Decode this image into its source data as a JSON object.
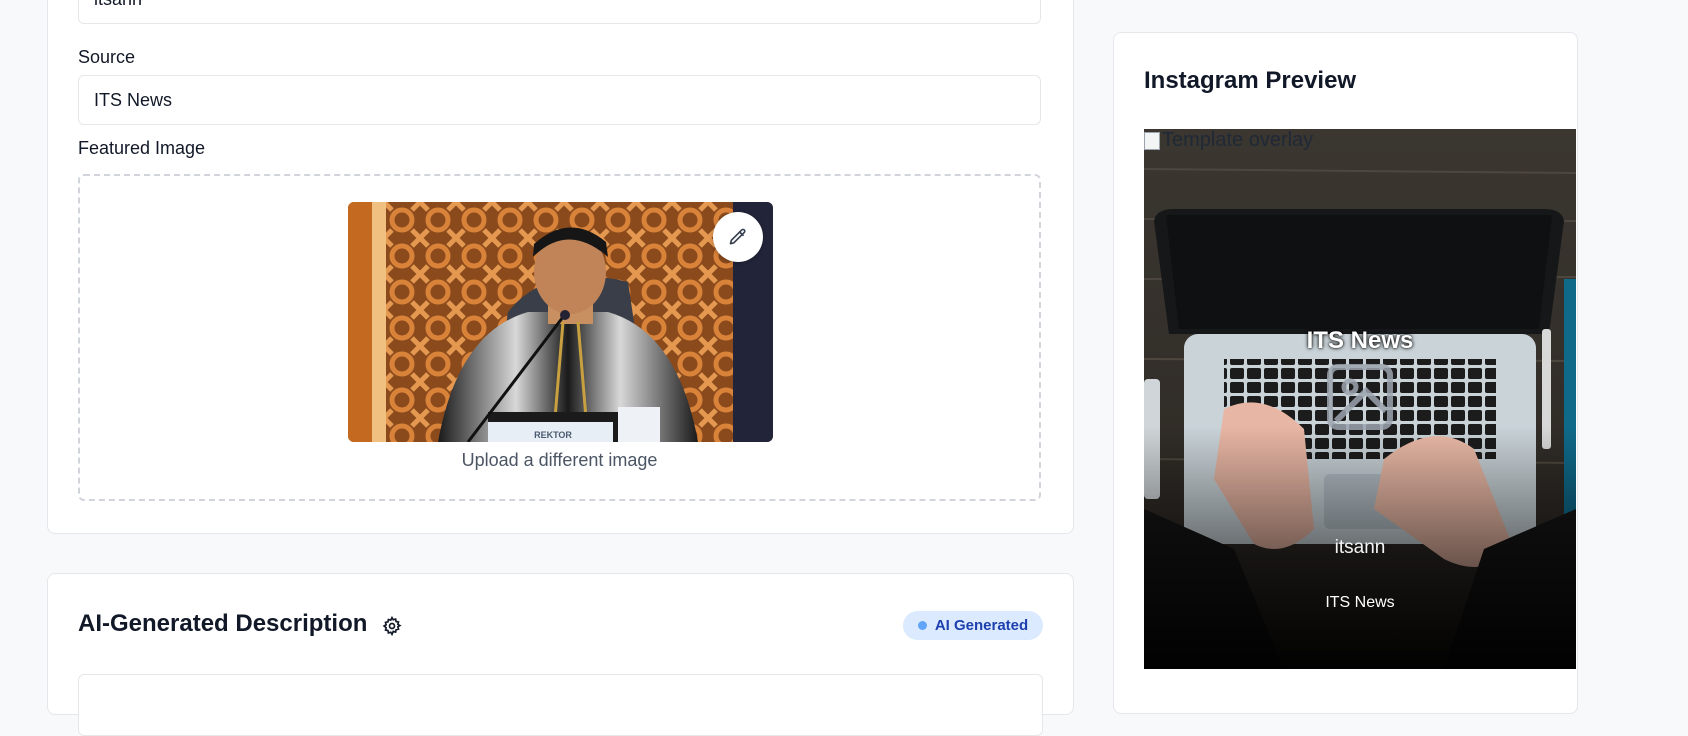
{
  "form": {
    "author_value": "itsann",
    "source_label": "Source",
    "source_value": "ITS News",
    "featured_label": "Featured Image",
    "photo_alt": "REKTOR",
    "upload_label": "Upload a different image"
  },
  "description": {
    "title": "AI-Generated Description",
    "badge": "AI Generated"
  },
  "preview": {
    "title": "Instagram Preview",
    "overlay_alt": "Template overlay",
    "headline": "ITS News",
    "author": "itsann",
    "source": "ITS News"
  },
  "icons": {
    "edit": "pencil-icon",
    "settings": "gear-icon",
    "placeholder": "image-placeholder-icon",
    "broken": "broken-image-icon"
  },
  "colors": {
    "page_bg": "#f8f9fb",
    "card_border": "#e5e7eb",
    "badge_bg": "#dbeafe",
    "badge_text": "#1e40af",
    "badge_dot": "#60a5fa"
  }
}
